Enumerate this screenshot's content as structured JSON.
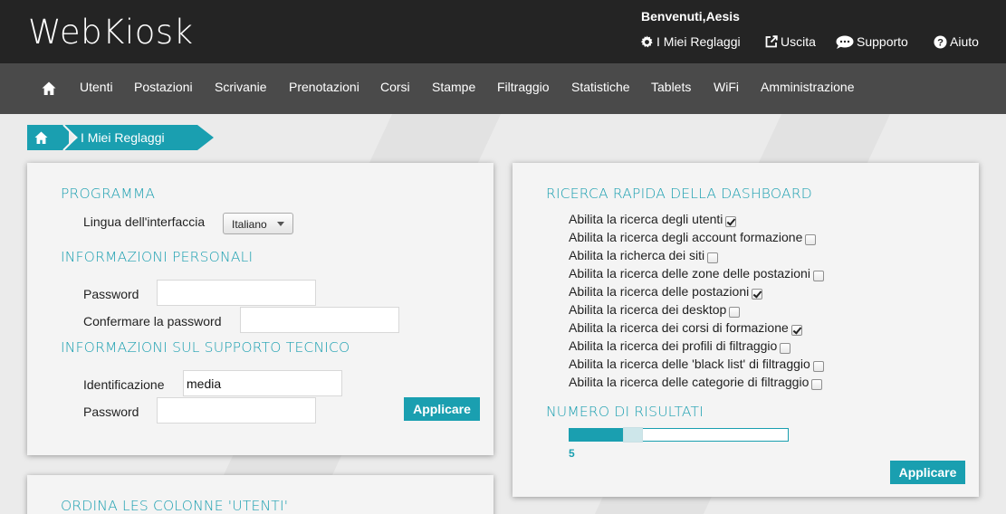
{
  "header": {
    "logo": "WebKiosk",
    "welcome": "Benvenuti,Aesis",
    "links": [
      {
        "label": "I Miei Reglaggi",
        "icon": "gear-icon"
      },
      {
        "label": "Uscita",
        "icon": "external-link-icon"
      },
      {
        "label": "Supporto",
        "icon": "chat-bubble-icon"
      },
      {
        "label": "Aiuto",
        "icon": "question-circle-icon"
      }
    ]
  },
  "nav": {
    "home_icon": "home-icon",
    "items": [
      "Utenti",
      "Postazioni",
      "Scrivanie",
      "Prenotazioni",
      "Corsi",
      "Stampe",
      "Filtraggio",
      "Statistiche",
      "Tablets",
      "WiFi",
      "Amministrazione"
    ]
  },
  "breadcrumb": {
    "current": "I Miei Reglaggi"
  },
  "settings_panel": {
    "program_title": "PROGRAMMA",
    "language_label": "Lingua dell'interfaccia",
    "language_value": "Italiano",
    "personal_title": "INFORMAZIONI PERSONALI",
    "password_label": "Password",
    "password_value": "",
    "confirm_label": "Confermare la password",
    "confirm_value": "",
    "support_title": "INFORMAZIONI SUL SUPPORTO TECNICO",
    "id_label": "Identificazione",
    "id_value": "media",
    "support_password_label": "Password",
    "support_password_value": "",
    "apply_label": "Applicare"
  },
  "columns_panel": {
    "title": "ORDINA LES COLONNE 'UTENTI'"
  },
  "dashboard_panel": {
    "title": "RICERCA RAPIDA DELLA DASHBOARD",
    "options": [
      {
        "label": "Abilita la ricerca degli utenti",
        "checked": true
      },
      {
        "label": "Abilita la ricerca degli account formazione",
        "checked": false
      },
      {
        "label": "Abilita la richerca dei siti",
        "checked": false
      },
      {
        "label": "Abilita la ricerca delle zone delle postazioni",
        "checked": false
      },
      {
        "label": "Abilita la ricerca delle postazioni",
        "checked": true
      },
      {
        "label": "Abilita la ricerca dei desktop",
        "checked": false
      },
      {
        "label": "Abilita la ricerca dei corsi di formazione",
        "checked": true
      },
      {
        "label": "Abilita la ricerca dei profili di filtraggio",
        "checked": false
      },
      {
        "label": "Abilita la ricerca delle 'black list' di filtraggio",
        "checked": false
      },
      {
        "label": "Abilita la ricerca delle categorie di filtraggio",
        "checked": false
      }
    ],
    "results_title": "NUMERO DI RISULTATI",
    "results_value": "5",
    "results_fraction": 0.25,
    "apply_label": "Applicare"
  },
  "colors": {
    "accent": "#1a9fb0",
    "header_bg": "#242424",
    "nav_bg": "#4a4a4a"
  }
}
